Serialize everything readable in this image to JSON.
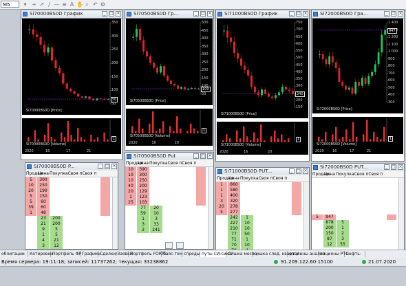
{
  "toolbar": {
    "timeframe": "M5"
  },
  "charts": [
    {
      "title": "Si70000BS0D График",
      "legend": "Si70000BS0D [Price]",
      "vol_legend": "Si70000BS0D [Volume]",
      "price_ticks": [
        "350",
        "300",
        "250",
        "200",
        "150",
        "100",
        "50"
      ],
      "price_marker": "50",
      "date_labels": [
        "2020",
        "16",
        "17",
        "21"
      ],
      "vol_marker": "1",
      "price": [
        320,
        300,
        290,
        260,
        230,
        250,
        200,
        170,
        150,
        110,
        90,
        80,
        70,
        60,
        55,
        60,
        50,
        45,
        52,
        50,
        48,
        50
      ],
      "volume": [
        2,
        0,
        5,
        1,
        0,
        3,
        8,
        2,
        1,
        0,
        4,
        2,
        9,
        3,
        1,
        6,
        2,
        1,
        0,
        3,
        1,
        2,
        0,
        4,
        1
      ]
    },
    {
      "title": "Si70500BS0D Гр...",
      "legend": "Si70500BS0D [Price]",
      "vol_legend": "Si70500BS0D [Volume]",
      "price_ticks": [
        "500",
        "450",
        "400",
        "350",
        "300",
        "250",
        "200",
        "150",
        "100",
        "50"
      ],
      "price_marker": "100",
      "date_labels": [
        "2020",
        "16",
        "20"
      ],
      "vol_marker": "1",
      "price": [
        420,
        470,
        400,
        330,
        300,
        260,
        230,
        200,
        240,
        180,
        150,
        130,
        120,
        100,
        110,
        95,
        100,
        105,
        100,
        100
      ],
      "volume": [
        3,
        1,
        6,
        2,
        0,
        4,
        9,
        1,
        2,
        5,
        0,
        3,
        1,
        7,
        2,
        0,
        1,
        4,
        2,
        1
      ]
    },
    {
      "title": "Si71000BS0D График",
      "legend": "Si71000BS0D [Price]",
      "vol_legend": "Si71000BS0D [Volume]",
      "price_ticks": [
        "750",
        "700",
        "650",
        "600",
        "550",
        "500",
        "450",
        "400",
        "350",
        "300",
        "250",
        "200",
        "150"
      ],
      "price_marker": "240",
      "date_labels": [
        "2020",
        "16",
        "20"
      ],
      "vol_marker": "1",
      "price": [
        700,
        650,
        620,
        540,
        500,
        450,
        420,
        380,
        300,
        260,
        240,
        280,
        250,
        230,
        220,
        240,
        260,
        300,
        280,
        270,
        250
      ],
      "volume": [
        1,
        4,
        2,
        0,
        6,
        2,
        8,
        3,
        1,
        5,
        2,
        9,
        1,
        0,
        3,
        6,
        2,
        4,
        1,
        2,
        0
      ]
    },
    {
      "title": "Si72000BS0D Гра...",
      "legend": "Si72000BS0D [Price]",
      "vol_legend": "Si72000BS0D [Volume]",
      "price_ticks": [
        "1 400",
        "1 300",
        "1 200",
        "1 100",
        "1 000",
        "900",
        "800",
        "700",
        "600",
        "500",
        "400",
        "300"
      ],
      "price_marker": "947",
      "date_labels": [
        "2020",
        "16",
        "17",
        "21"
      ],
      "vol_marker": "1",
      "price": [
        700,
        650,
        600,
        680,
        620,
        560,
        420,
        380,
        340,
        360,
        300,
        420,
        380,
        460,
        400,
        480,
        520,
        600,
        720,
        900,
        947
      ],
      "volume": [
        2,
        1,
        4,
        0,
        3,
        6,
        1,
        2,
        5,
        1,
        8,
        2,
        0,
        3,
        9,
        1,
        4,
        2,
        1,
        6
      ]
    }
  ],
  "books": [
    {
      "title": "Si70000BS0D P...",
      "headers": [
        "Продаж",
        "Цена",
        "ПокупкаСвоя пСвоя п"
      ],
      "sell": [
        [
          "5",
          "300"
        ],
        [
          "10",
          "250"
        ],
        [
          "20",
          "190"
        ],
        [
          "5",
          "150"
        ],
        [
          "5",
          "60"
        ],
        [
          "39",
          "60"
        ],
        [
          "1",
          "48"
        ]
      ],
      "buy": [
        [
          "23",
          "200"
        ],
        [
          "21",
          "200"
        ],
        [
          "9",
          "5"
        ],
        [
          "1",
          "5"
        ],
        [
          "4",
          "21"
        ],
        [
          "3",
          "12"
        ],
        [
          "2",
          "118"
        ]
      ]
    },
    {
      "title": "Si70500BS0D Put",
      "headers": [
        "Продаж",
        "Цена",
        "ПокупкаСвоя пСвоя п"
      ],
      "sell": [
        [
          "10",
          "390"
        ],
        [
          "10",
          "300"
        ],
        [
          "10",
          "250"
        ],
        [
          "40",
          "200"
        ],
        [
          "20",
          "129"
        ],
        [
          "1",
          "123"
        ],
        [
          "25",
          "103"
        ]
      ],
      "buy": [
        [
          "77",
          "20"
        ],
        [
          "59",
          "10"
        ],
        [
          "1",
          "3"
        ],
        [
          "3",
          "33"
        ],
        [
          "2",
          "241"
        ]
      ]
    },
    {
      "title": "Si71000BS0D PUT...",
      "headers": [
        "Продаж",
        "Цена",
        "ПокупкаСвоя пСвоя п"
      ],
      "sell": [
        [
          "1",
          "860"
        ],
        [
          "1",
          "580"
        ],
        [
          "1",
          "400"
        ],
        [
          "3",
          "320"
        ],
        [
          "20",
          "278"
        ],
        [
          "5",
          "277"
        ]
      ],
      "buy": [
        [
          "242",
          "1"
        ],
        [
          "227",
          "10"
        ],
        [
          "210",
          "10"
        ],
        [
          "77",
          "50"
        ],
        [
          "71",
          "1"
        ],
        [
          "70",
          "10"
        ],
        [
          "70",
          "4"
        ]
      ]
    },
    {
      "title": "Si72000BS0D PUT...",
      "headers": [
        "Продаж",
        "Цена",
        "ПокупкаСвоя пСвоя п"
      ],
      "sell": [
        [
          "5",
          "947"
        ]
      ],
      "buy": [
        [
          "878",
          "5"
        ],
        [
          "200",
          "1"
        ],
        [
          "150",
          "2"
        ],
        [
          "87",
          "3"
        ],
        [
          "12",
          "55"
        ]
      ]
    }
  ],
  "tabs": [
    "облигации",
    "Котировки",
    "Портфель ФР",
    "Графики",
    "Сделки/Заявки",
    "Портфель FORTS",
    "баяс-том",
    "спреды",
    "путы СИ-сика",
    "СИшка месяц",
    "сишка след. квартал.",
    "опционы анализ",
    "опционы РТС",
    "нефть-"
  ],
  "active_tab": "путы СИ-сика",
  "status": {
    "text": "Время сервера: 19:11:18; записей: 11737262; текущая: 33238862",
    "ip": "91.209.122.60:15100",
    "date": "21.07.2020"
  },
  "colors": {
    "bull": "#22c55e",
    "bear": "#dc2626",
    "line": "#8a2be2",
    "volume": "#e03030",
    "bid": "#a7dc8f",
    "ask": "#f4a7a7"
  }
}
